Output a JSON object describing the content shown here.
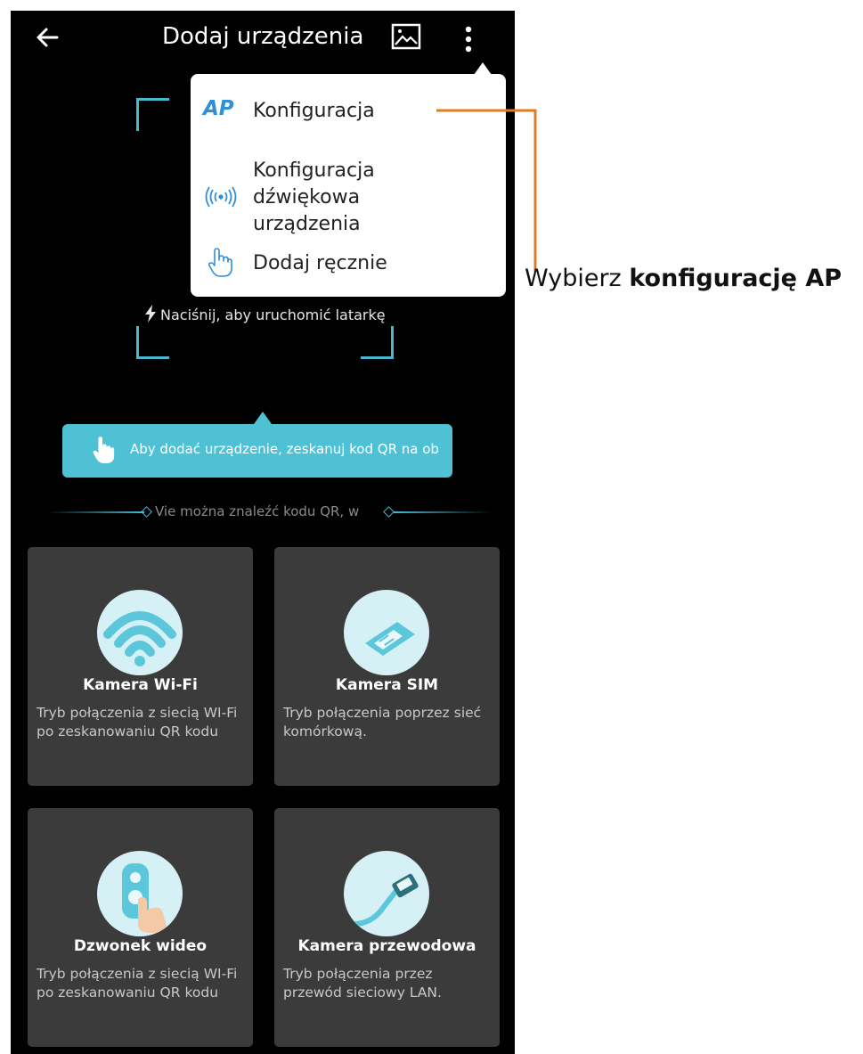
{
  "header": {
    "title": "Dodaj urządzenia"
  },
  "menu": {
    "items": [
      {
        "badge": "AP",
        "label": "Konfiguracja",
        "icon": "ap-icon"
      },
      {
        "label": "Konfiguracja dźwiękowa urządzenia",
        "line1": "Konfiguracja",
        "line2": "dźwiękowa",
        "line3": "urządzenia",
        "icon": "sound-wave-icon"
      },
      {
        "label": "Dodaj ręcznie",
        "icon": "hand-pointer-icon"
      }
    ]
  },
  "scanner": {
    "torch_text": "Naciśnij, aby uruchomić latarkę",
    "torch_icon": "flash-icon"
  },
  "hint": {
    "text": "Aby dodać urządzenie, zeskanuj kod QR na ob"
  },
  "not_found": {
    "text": "Vie można znaleźć kodu QR, w"
  },
  "cards": [
    {
      "title": "Kamera Wi-Fi",
      "desc": "Tryb połączenia z siecią WI-Fi po zeskanowaniu QR kodu",
      "icon": "wifi-icon"
    },
    {
      "title": "Kamera SIM",
      "desc": "Tryb połączenia poprzez sieć komórkową.",
      "icon": "sim-card-icon"
    },
    {
      "title": "Dzwonek wideo",
      "desc": "Tryb połączenia z siecią WI-Fi po zeskanowaniu QR kodu",
      "icon": "doorbell-icon"
    },
    {
      "title": "Kamera przewodowa",
      "desc": "Tryb połączenia przez przewód sieciowy LAN.",
      "icon": "lan-cable-icon"
    }
  ],
  "callout": {
    "prefix": "Wybierz ",
    "bold": "konfigurację AP",
    "line_color": "#e07b25"
  },
  "colors": {
    "accent": "#4fc1d5",
    "frame": "#49b9d2",
    "background": "#000000",
    "card": "#3b3b3b"
  }
}
